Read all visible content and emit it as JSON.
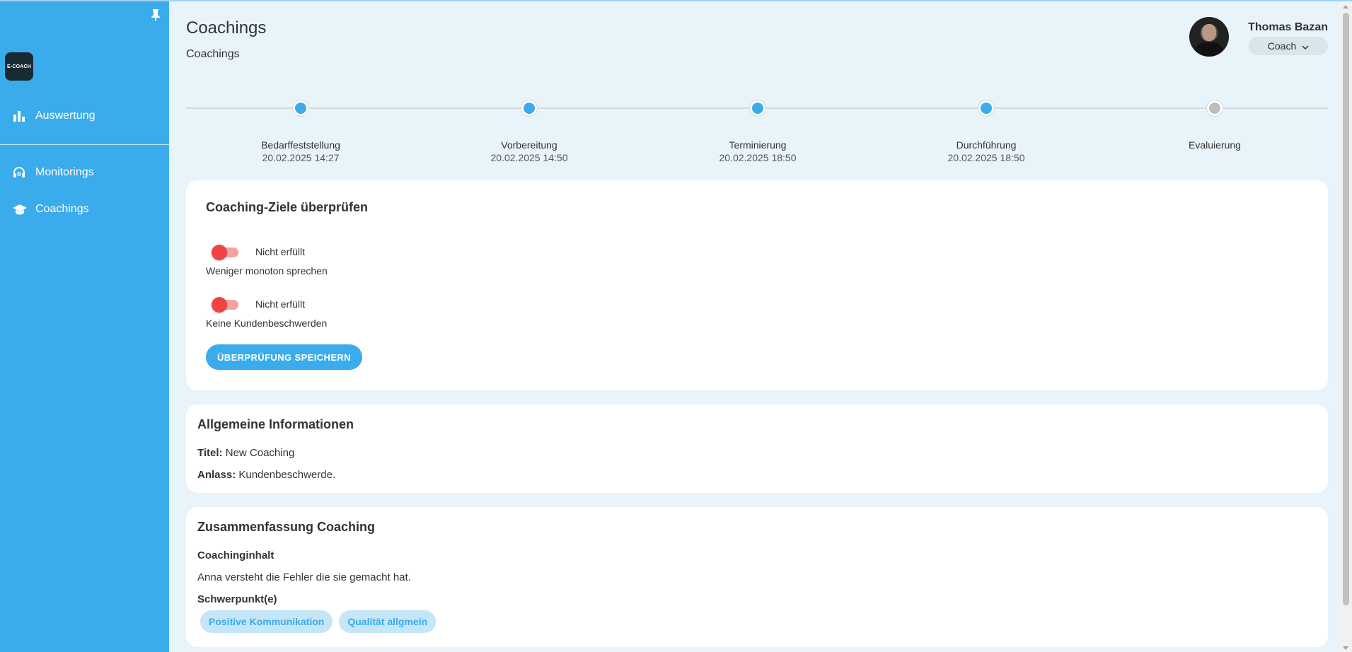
{
  "sidebar": {
    "logo_text": "E-COACH",
    "pin_icon": "pin-icon",
    "items": [
      {
        "label": "Auswertung",
        "icon": "bar-chart-icon"
      },
      {
        "label": "Monitorings",
        "icon": "headset-icon"
      },
      {
        "label": "Coachings",
        "icon": "graduation-cap-icon"
      }
    ]
  },
  "header": {
    "title": "Coachings",
    "breadcrumb": "Coachings"
  },
  "user": {
    "name": "Thomas Bazan",
    "role": "Coach"
  },
  "stepper": {
    "steps": [
      {
        "label": "Bedarffeststellung",
        "date": "20.02.2025 14:27",
        "status": "done"
      },
      {
        "label": "Vorbereitung",
        "date": "20.02.2025 14:50",
        "status": "done"
      },
      {
        "label": "Terminierung",
        "date": "20.02.2025 18:50",
        "status": "done"
      },
      {
        "label": "Durchführung",
        "date": "20.02.2025 18:50",
        "status": "done"
      },
      {
        "label": "Evaluierung",
        "date": "",
        "status": "pending"
      }
    ]
  },
  "goals_card": {
    "title": "Coaching-Ziele überprüfen",
    "goals": [
      {
        "status": "Nicht erfüllt",
        "text": "Weniger monoton sprechen",
        "fulfilled": false
      },
      {
        "status": "Nicht erfüllt",
        "text": "Keine Kundenbeschwerden",
        "fulfilled": false
      }
    ],
    "save_label": "ÜBERPRÜFUNG SPEICHERN"
  },
  "info_card": {
    "title": "Allgemeine Informationen",
    "title_label": "Titel:",
    "title_value": "New Coaching",
    "reason_label": "Anlass:",
    "reason_value": "Kundenbeschwerde."
  },
  "summary_card": {
    "title": "Zusammenfassung Coaching",
    "content_label": "Coachinginhalt",
    "content_text": "Anna versteht die Fehler die sie gemacht hat.",
    "focus_label": "Schwerpunkt(e)",
    "focus_chips": [
      "Positive Kommunikation",
      "Qualität allgmein"
    ]
  },
  "colors": {
    "primary": "#3aabeb",
    "background": "#e8f4f9",
    "error": "#ef4444",
    "pending": "#bdbdbd"
  }
}
